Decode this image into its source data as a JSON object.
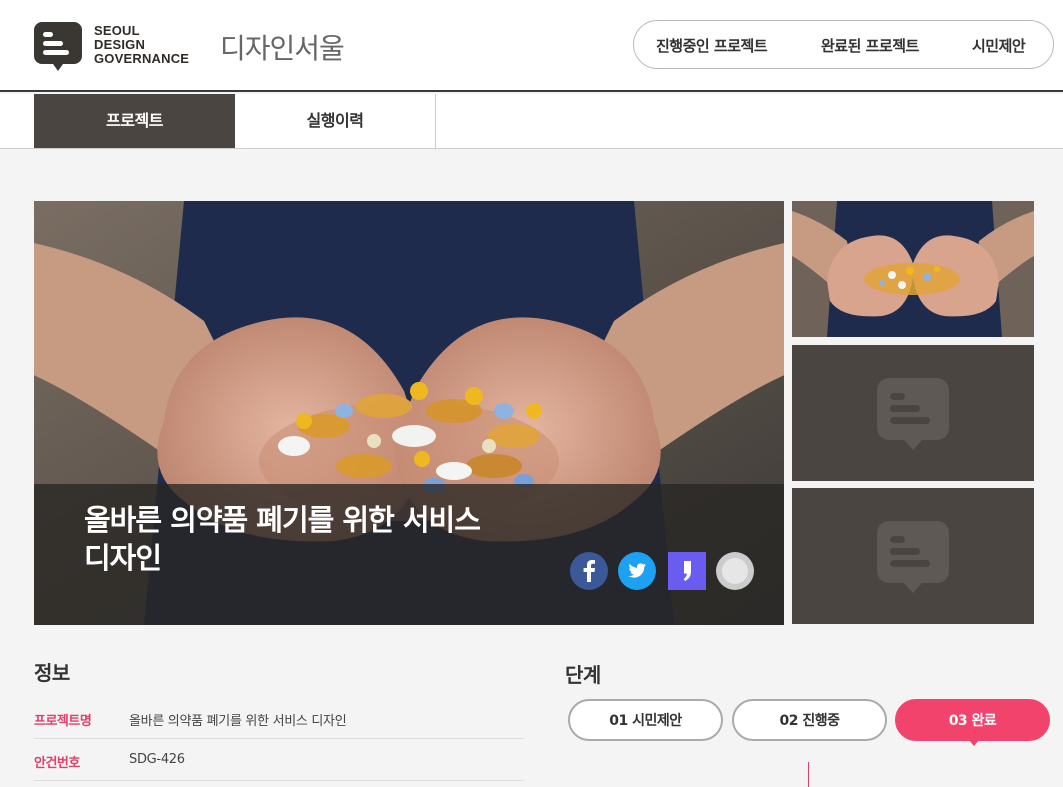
{
  "header": {
    "logo_lines": [
      "SEOUL",
      "DESIGN",
      "GOVERNANCE"
    ],
    "site_title": "디자인서울",
    "nav": [
      "진행중인 프로젝트",
      "완료된 프로젝트",
      "시민제안"
    ]
  },
  "subtabs": [
    "프로젝트",
    "실행이력"
  ],
  "hero": {
    "title": "올바른 의약품 폐기를 위한 서비스 디자인",
    "share_icons": [
      "facebook-icon",
      "twitter-icon",
      "pinboard-comma-icon",
      "link-icon"
    ]
  },
  "info": {
    "heading": "정보",
    "rows": [
      {
        "label": "프로젝트명",
        "value": "올바른 의약품 폐기를 위한 서비스 디자인"
      },
      {
        "label": "안건번호",
        "value": "SDG-426"
      }
    ]
  },
  "stages": {
    "heading": "단계",
    "items": [
      "01 시민제안",
      "02 진행중",
      "03 완료"
    ],
    "active_index": 2
  },
  "colors": {
    "accent": "#f2436c",
    "dark": "#4a4541",
    "label": "#e0406a",
    "facebook": "#3b5998",
    "twitter": "#1da1f2",
    "pin": "#6a5cf0"
  }
}
